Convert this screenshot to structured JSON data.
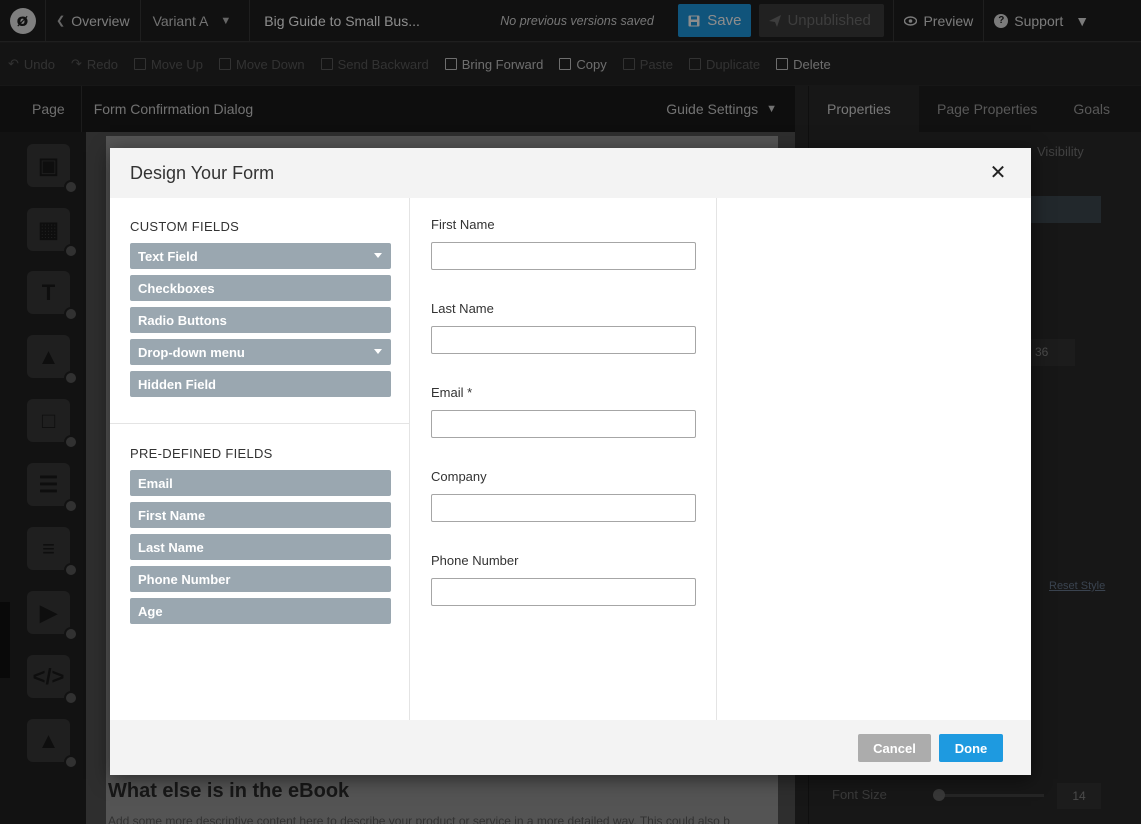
{
  "topbar": {
    "logo_glyph": "ø",
    "overview_label": "Overview",
    "variant_label": "Variant A",
    "page_title": "Big Guide to Small Bus...",
    "version_status": "No previous versions saved",
    "save_label": "Save",
    "unpublished_label": "Unpublished",
    "preview_label": "Preview",
    "support_label": "Support"
  },
  "toolbar": {
    "tools": [
      "Undo",
      "Redo",
      "Move Up",
      "Move Down",
      "Send Backward",
      "Bring Forward",
      "Copy",
      "Paste",
      "Duplicate",
      "Delete"
    ]
  },
  "pagebar": {
    "page_tab": "Page",
    "page_name": "Form Confirmation Dialog",
    "guide_settings": "Guide Settings"
  },
  "right_panel": {
    "tabs": [
      "Properties",
      "Page Properties",
      "Goals"
    ],
    "visibility_label": "Visibility",
    "number_value": "36",
    "reset_style": "Reset Style",
    "font_size_label": "Font Size",
    "font_size_value": "14"
  },
  "canvas": {
    "heading": "What else is in the eBook",
    "paragraph": "Add some more descriptive content here to describe your product or service in a more detailed way. This could also b"
  },
  "modal": {
    "title": "Design Your Form",
    "custom_fields_title": "CUSTOM FIELDS",
    "custom_fields": [
      "Text Field",
      "Checkboxes",
      "Radio Buttons",
      "Drop-down menu",
      "Hidden Field"
    ],
    "predefined_fields_title": "PRE-DEFINED FIELDS",
    "predefined_fields": [
      "Email",
      "First Name",
      "Last Name",
      "Phone Number",
      "Age"
    ],
    "form_fields": [
      {
        "label": "First Name",
        "value": ""
      },
      {
        "label": "Last Name",
        "value": ""
      },
      {
        "label": "Email *",
        "value": ""
      },
      {
        "label": "Company",
        "value": ""
      },
      {
        "label": "Phone Number",
        "value": ""
      }
    ],
    "cancel_label": "Cancel",
    "done_label": "Done"
  },
  "colors": {
    "accent": "#1e9ae0",
    "field_button": "#9aa7b0",
    "cancel_button": "#acacac"
  }
}
